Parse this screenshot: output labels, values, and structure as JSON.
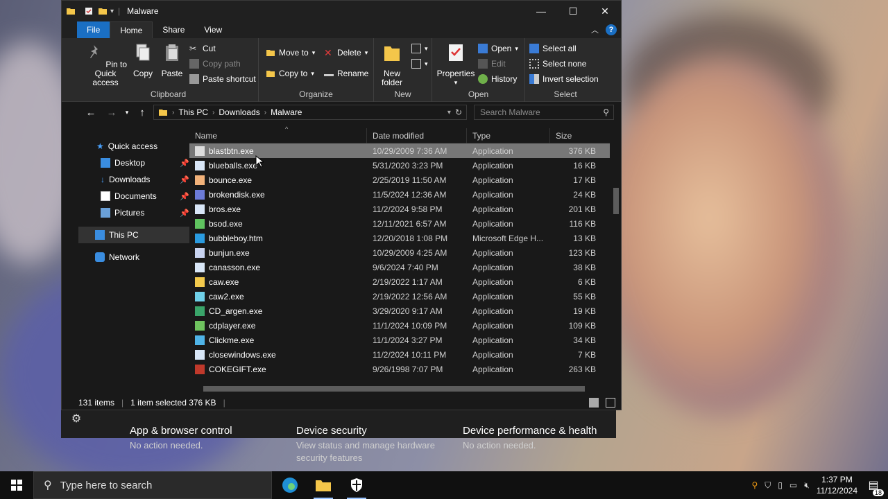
{
  "explorer": {
    "title": "Malware",
    "window_controls": {
      "minimize": "—",
      "maximize": "☐",
      "close": "✕"
    },
    "tabs": [
      {
        "label": "File"
      },
      {
        "label": "Home"
      },
      {
        "label": "Share"
      },
      {
        "label": "View"
      }
    ],
    "ribbon": {
      "clipboard": {
        "label": "Clipboard",
        "pin": "Pin to Quick access",
        "copy": "Copy",
        "paste": "Paste",
        "cut": "Cut",
        "copy_path": "Copy path",
        "paste_shortcut": "Paste shortcut"
      },
      "organize": {
        "label": "Organize",
        "move_to": "Move to",
        "copy_to": "Copy to",
        "delete": "Delete",
        "rename": "Rename"
      },
      "new": {
        "label": "New",
        "new_folder": "New folder"
      },
      "open": {
        "label": "Open",
        "properties": "Properties",
        "open": "Open",
        "edit": "Edit",
        "history": "History"
      },
      "select": {
        "label": "Select",
        "select_all": "Select all",
        "select_none": "Select none",
        "invert": "Invert selection"
      }
    },
    "address": {
      "crumbs": [
        "This PC",
        "Downloads",
        "Malware"
      ]
    },
    "search": {
      "placeholder": "Search Malware"
    },
    "nav_pane": {
      "quick_access": "Quick access",
      "desktop": "Desktop",
      "downloads": "Downloads",
      "documents": "Documents",
      "pictures": "Pictures",
      "this_pc": "This PC",
      "network": "Network"
    },
    "columns": {
      "name": "Name",
      "date": "Date modified",
      "type": "Type",
      "size": "Size"
    },
    "files": [
      {
        "name": "blastbtn.exe",
        "date": "10/29/2009 7:36 AM",
        "type": "Application",
        "size": "376 KB"
      },
      {
        "name": "blueballs.exe",
        "date": "5/31/2020 3:23 PM",
        "type": "Application",
        "size": "16 KB"
      },
      {
        "name": "bounce.exe",
        "date": "2/25/2019 11:50 AM",
        "type": "Application",
        "size": "17 KB"
      },
      {
        "name": "brokendisk.exe",
        "date": "11/5/2024 12:36 AM",
        "type": "Application",
        "size": "24 KB"
      },
      {
        "name": "bros.exe",
        "date": "11/2/2024 9:58 PM",
        "type": "Application",
        "size": "201 KB"
      },
      {
        "name": "bsod.exe",
        "date": "12/11/2021 6:57 AM",
        "type": "Application",
        "size": "116 KB"
      },
      {
        "name": "bubbleboy.htm",
        "date": "12/20/2018 1:08 PM",
        "type": "Microsoft Edge H...",
        "size": "13 KB"
      },
      {
        "name": "bunjun.exe",
        "date": "10/29/2009 4:25 AM",
        "type": "Application",
        "size": "123 KB"
      },
      {
        "name": "canasson.exe",
        "date": "9/6/2024 7:40 PM",
        "type": "Application",
        "size": "38 KB"
      },
      {
        "name": "caw.exe",
        "date": "2/19/2022 1:17 AM",
        "type": "Application",
        "size": "6 KB"
      },
      {
        "name": "caw2.exe",
        "date": "2/19/2022 12:56 AM",
        "type": "Application",
        "size": "55 KB"
      },
      {
        "name": "CD_argen.exe",
        "date": "3/29/2020 9:17 AM",
        "type": "Application",
        "size": "19 KB"
      },
      {
        "name": "cdplayer.exe",
        "date": "11/1/2024 10:09 PM",
        "type": "Application",
        "size": "109 KB"
      },
      {
        "name": "Clickme.exe",
        "date": "11/1/2024 3:27 PM",
        "type": "Application",
        "size": "34 KB"
      },
      {
        "name": "closewindows.exe",
        "date": "11/2/2024 10:11 PM",
        "type": "Application",
        "size": "7 KB"
      },
      {
        "name": "COKEGIFT.exe",
        "date": "9/26/1998 7:07 PM",
        "type": "Application",
        "size": "263 KB"
      }
    ],
    "status": {
      "count": "131 items",
      "selected": "1 item selected  376 KB"
    }
  },
  "security_app": {
    "tile1": {
      "title": "App & browser control",
      "desc": "No action needed."
    },
    "tile2": {
      "title": "Device security",
      "desc": "View status and manage hardware security features"
    },
    "tile3": {
      "title": "Device performance & health",
      "desc": "No action needed."
    }
  },
  "taskbar": {
    "search_placeholder": "Type here to search",
    "time": "1:37 PM",
    "date": "11/12/2024",
    "notifications": "18"
  }
}
